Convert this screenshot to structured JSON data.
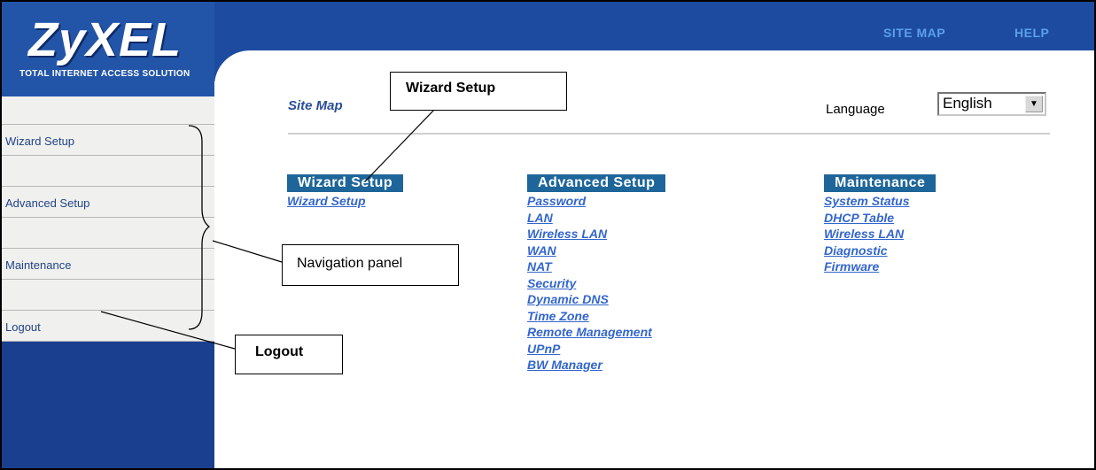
{
  "brand": {
    "logo": "ZyXEL",
    "tagline": "TOTAL INTERNET ACCESS SOLUTION"
  },
  "top_links": {
    "site_map": "SITE MAP",
    "help": "HELP"
  },
  "page": {
    "title": "Site Map",
    "language_label": "Language",
    "language_value": "English"
  },
  "nav": {
    "items": [
      "Wizard Setup",
      "Advanced Setup",
      "Maintenance",
      "Logout"
    ]
  },
  "columns": [
    {
      "header": "Wizard Setup",
      "links": [
        "Wizard Setup"
      ]
    },
    {
      "header": "Advanced Setup",
      "links": [
        "Password",
        "LAN",
        "Wireless LAN",
        "WAN",
        "NAT",
        "Security",
        "Dynamic DNS",
        "Time Zone",
        "Remote Management",
        "UPnP",
        "BW Manager"
      ]
    },
    {
      "header": "Maintenance",
      "links": [
        "System Status",
        "DHCP Table",
        "Wireless LAN",
        "Diagnostic",
        "Firmware"
      ]
    }
  ],
  "callouts": {
    "wizard_setup": "Wizard Setup",
    "navigation_panel": "Navigation panel",
    "logout": "Logout"
  },
  "colors": {
    "sidebar": "#1a3f8f",
    "topbar": "#1d4ba0",
    "header_bar": "#1e6699",
    "link": "#3366cc"
  }
}
